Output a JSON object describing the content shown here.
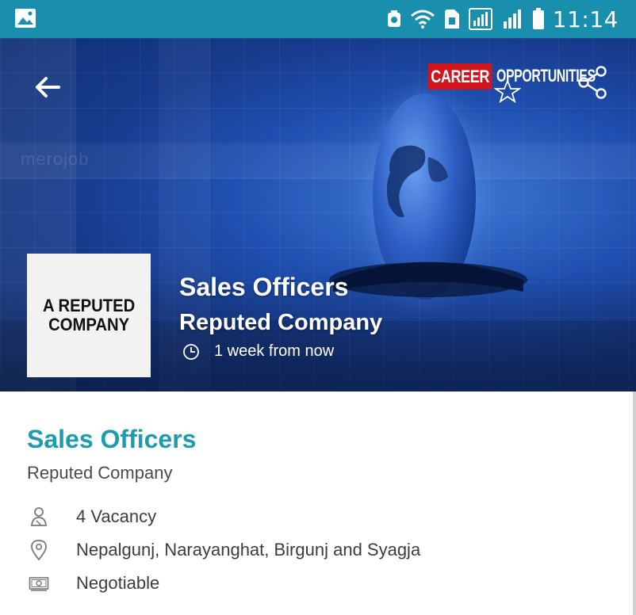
{
  "status_bar": {
    "time": "11:14",
    "icons": [
      "gallery-icon",
      "nfc-icon",
      "wifi-icon",
      "sim-icon",
      "signal-sim1-icon",
      "signal-sim2-icon",
      "battery-icon"
    ]
  },
  "banner": {
    "back_icon": "back-arrow-icon",
    "brand_logo": {
      "red_part": "CAREER",
      "white_part": "OPPORTUNITIES"
    },
    "share_icon": "share-icon",
    "watermark": "merojob",
    "company_logo_text": "A REPUTED COMPANY",
    "title": "Sales Officers",
    "company": "Reputed Company",
    "time_icon": "clock-icon",
    "deadline": "1 week from now"
  },
  "details": {
    "title": "Sales Officers",
    "company": "Reputed Company",
    "rows": [
      {
        "icon": "person-icon",
        "text": "4 Vacancy"
      },
      {
        "icon": "location-pin-icon",
        "text": "Nepalgunj, Narayanghat, Birgunj and Syagja"
      },
      {
        "icon": "money-icon",
        "text": "Negotiable"
      }
    ]
  },
  "colors": {
    "status_bar": "#1a8fad",
    "accent_title": "#1e9bae",
    "brand_red": "#d1151d"
  }
}
